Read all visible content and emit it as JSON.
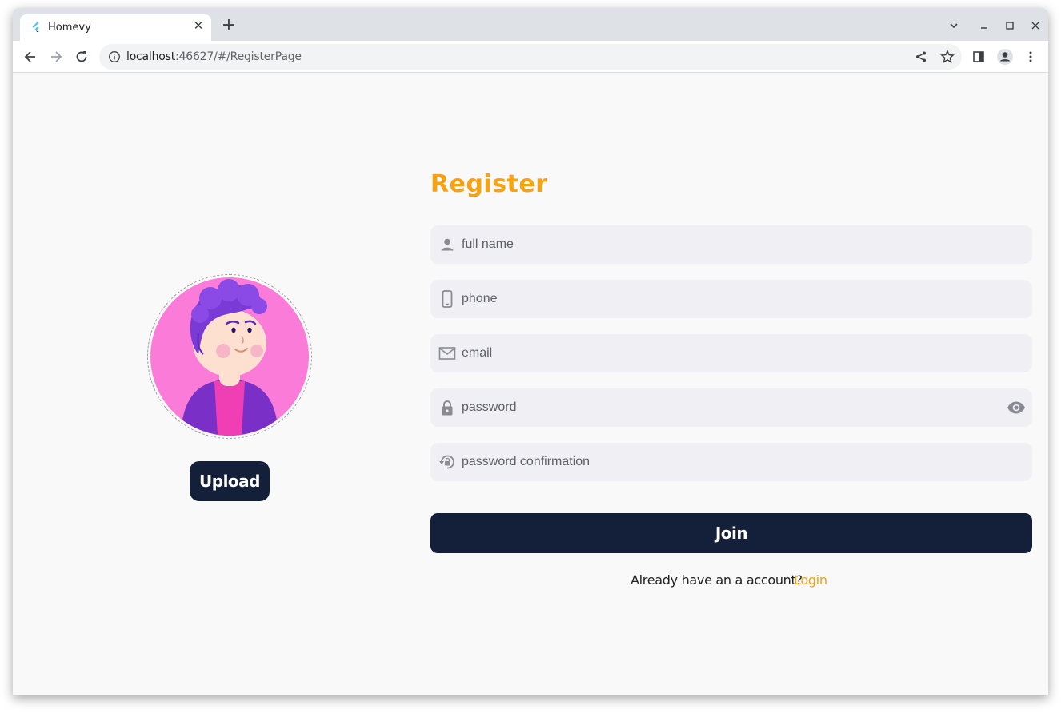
{
  "browser": {
    "tab_title": "Homevy",
    "url_host": "localhost",
    "url_rest": ":46627/#/RegisterPage"
  },
  "icons": {
    "favicon": "flutter-icon",
    "back": "arrow-left-icon",
    "forward": "arrow-right-icon",
    "reload": "reload-icon",
    "site_info": "info-icon",
    "share": "share-icon",
    "bookmark": "star-icon",
    "side_panel": "side-panel-icon",
    "profile": "profile-icon",
    "menu": "kebab-menu-icon"
  },
  "colors": {
    "accent": "#f5a313",
    "primary_dark": "#14203a",
    "field_bg": "#efeff4",
    "avatar_bg": "#fb7bd8"
  },
  "page": {
    "title": "Register",
    "upload_label": "Upload",
    "fields": {
      "full_name": {
        "placeholder": "full name",
        "icon": "person-icon"
      },
      "phone": {
        "placeholder": "phone",
        "icon": "smartphone-icon"
      },
      "email": {
        "placeholder": "email",
        "icon": "mail-icon"
      },
      "password": {
        "placeholder": "password",
        "icon": "lock-icon",
        "toggle_icon": "eye-icon"
      },
      "password_confirmation": {
        "placeholder": "password confirmation",
        "icon": "lock-reset-icon"
      }
    },
    "join_label": "Join",
    "already_text": "Already have an a account?",
    "login_label": "Login"
  }
}
